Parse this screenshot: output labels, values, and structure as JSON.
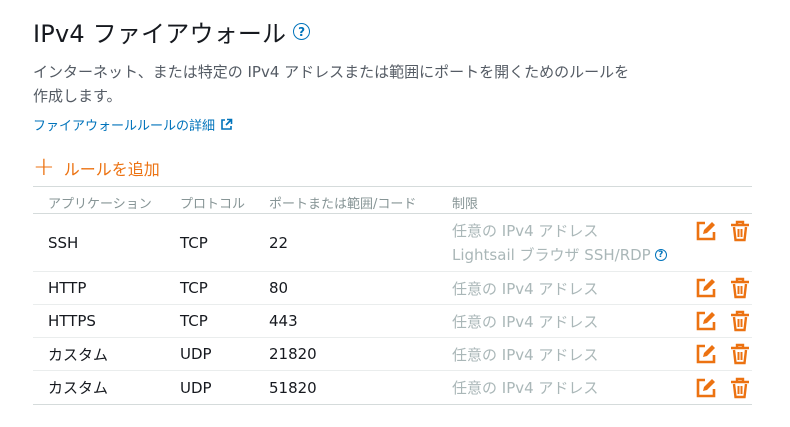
{
  "header": {
    "title": "IPv4 ファイアウォール",
    "help_icon": "question-circle-icon"
  },
  "description": "インターネット、または特定の IPv4 アドレスまたは範囲にポートを開くためのルールを作成します。",
  "learn_link": {
    "label": "ファイアウォールルールの詳細",
    "icon": "external-link-icon"
  },
  "add_rule": {
    "label": "ルールを追加",
    "icon": "plus-icon"
  },
  "colors": {
    "accent": "#ec7211",
    "link": "#0073bb",
    "muted": "#879596"
  },
  "table": {
    "columns": [
      "アプリケーション",
      "プロトコル",
      "ポートまたは範囲/コード",
      "制限"
    ],
    "rows": [
      {
        "app": "SSH",
        "protocol": "TCP",
        "port": "22",
        "restriction": "任意の IPv4 アドレス",
        "restriction_extra": "Lightsail ブラウザ SSH/RDP"
      },
      {
        "app": "HTTP",
        "protocol": "TCP",
        "port": "80",
        "restriction": "任意の IPv4 アドレス"
      },
      {
        "app": "HTTPS",
        "protocol": "TCP",
        "port": "443",
        "restriction": "任意の IPv4 アドレス"
      },
      {
        "app": "カスタム",
        "protocol": "UDP",
        "port": "21820",
        "restriction": "任意の IPv4 アドレス"
      },
      {
        "app": "カスタム",
        "protocol": "UDP",
        "port": "51820",
        "restriction": "任意の IPv4 アドレス"
      }
    ]
  }
}
